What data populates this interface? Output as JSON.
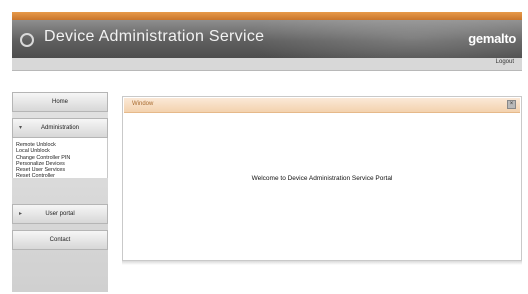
{
  "app": {
    "title": "Device Administration Service",
    "brand": "gemalto"
  },
  "header": {
    "logout_label": "Logout"
  },
  "sidebar": {
    "home_label": "Home",
    "admin_label": "Administration",
    "admin_items": [
      "Remote Unblock",
      "Local Unblock",
      "Change Controller PIN",
      "Personalize Devices",
      "Reset User Services",
      "Reset Controller"
    ],
    "user_portal_label": "User portal",
    "contact_label": "Contact"
  },
  "main": {
    "panel_title": "Window",
    "welcome_text": "Welcome to Device Administration Service Portal"
  },
  "colors": {
    "accent_orange": "#e08a3c",
    "header_gray": "#6e6e6e",
    "panel_header": "#f6dcc0"
  }
}
